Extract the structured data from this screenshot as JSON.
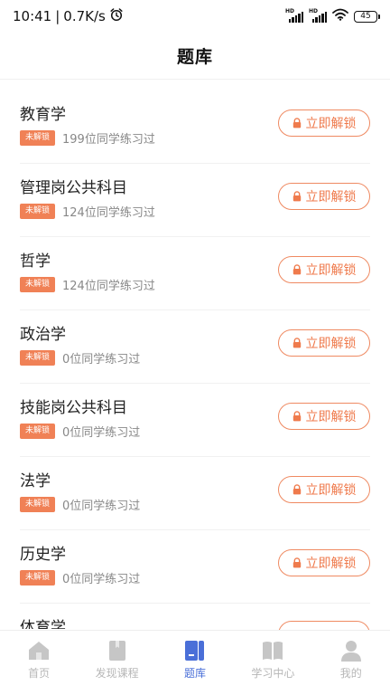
{
  "status_bar": {
    "time": "10:41",
    "speed": "0.7K/s",
    "battery": "45",
    "hd_label": "HD"
  },
  "header": {
    "title": "题库"
  },
  "items": [
    {
      "title": "教育学",
      "badge": "未解锁",
      "count": "199位同学练习过",
      "button": "立即解锁"
    },
    {
      "title": "管理岗公共科目",
      "badge": "未解锁",
      "count": "124位同学练习过",
      "button": "立即解锁"
    },
    {
      "title": "哲学",
      "badge": "未解锁",
      "count": "124位同学练习过",
      "button": "立即解锁"
    },
    {
      "title": "政治学",
      "badge": "未解锁",
      "count": "0位同学练习过",
      "button": "立即解锁"
    },
    {
      "title": "技能岗公共科目",
      "badge": "未解锁",
      "count": "0位同学练习过",
      "button": "立即解锁"
    },
    {
      "title": "法学",
      "badge": "未解锁",
      "count": "0位同学练习过",
      "button": "立即解锁"
    },
    {
      "title": "历史学",
      "badge": "未解锁",
      "count": "0位同学练习过",
      "button": "立即解锁"
    },
    {
      "title": "体育学",
      "badge": "",
      "count": "",
      "button": ""
    }
  ],
  "tabbar": {
    "tabs": [
      {
        "label": "首页",
        "icon": "home-icon",
        "active": false
      },
      {
        "label": "发现课程",
        "icon": "book-icon",
        "active": false
      },
      {
        "label": "题库",
        "icon": "question-bank-icon",
        "active": true
      },
      {
        "label": "学习中心",
        "icon": "study-center-icon",
        "active": false
      },
      {
        "label": "我的",
        "icon": "user-icon",
        "active": false
      }
    ]
  },
  "colors": {
    "accent_orange": "#ef7a4c",
    "badge_orange": "#f08156",
    "active_tab_blue": "#4a6fd8",
    "inactive_tab_gray": "#b7b7b7"
  }
}
